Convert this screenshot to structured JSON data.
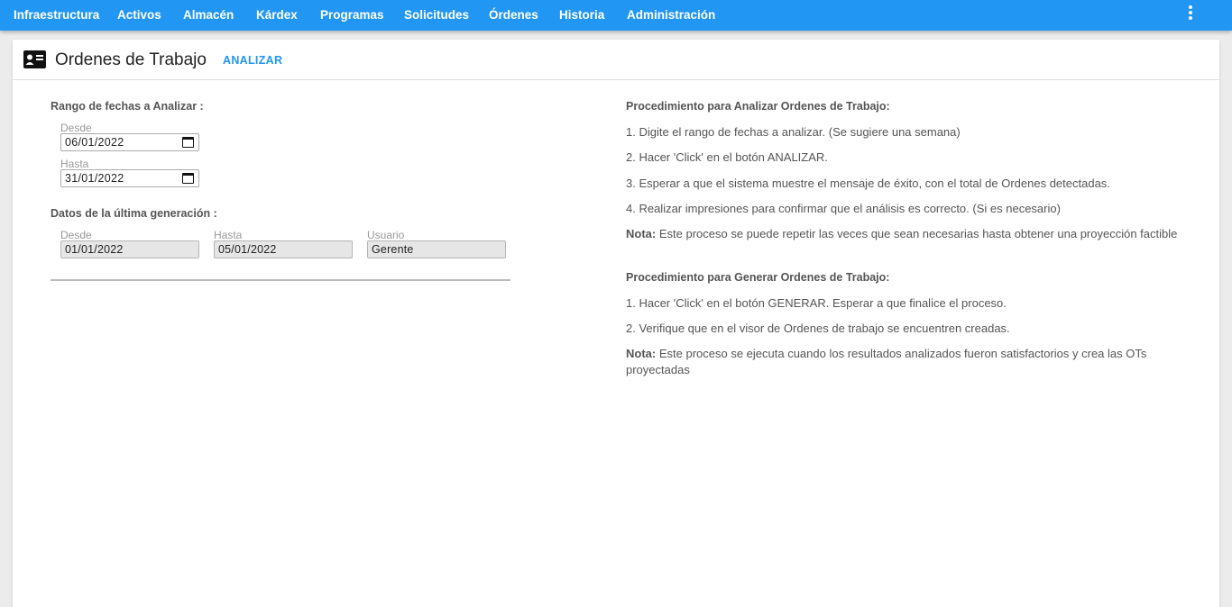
{
  "nav": {
    "items": [
      "Infraestructura",
      "Activos",
      "Almacén",
      "Kárdex",
      "Programas",
      "Solicitudes",
      "Órdenes",
      "Historia",
      "Administración"
    ],
    "more_icon": "more-vertical-icon",
    "color": "#2196f3"
  },
  "header": {
    "icon": "id-card-icon",
    "title": "Ordenes de Trabajo",
    "action_label": "ANALIZAR"
  },
  "range": {
    "section_label": "Rango de fechas a Analizar :",
    "from_label": "Desde",
    "from_value": "06/01/2022",
    "to_label": "Hasta",
    "to_value": "31/01/2022"
  },
  "last_generation": {
    "section_label": "Datos de la última generación :",
    "from_label": "Desde",
    "from_value": "01/01/2022",
    "to_label": "Hasta",
    "to_value": "05/01/2022",
    "user_label": "Usuario",
    "user_value": "Gerente"
  },
  "analyze_procedure": {
    "title": "Procedimiento para Analizar Ordenes de Trabajo:",
    "steps": [
      "1. Digite el rango de fechas a analizar. (Se sugiere una semana)",
      "2. Hacer 'Click' en el botón ANALIZAR.",
      "3. Esperar a que el sistema muestre el mensaje de éxito, con el total de Ordenes detectadas.",
      "4. Realizar impresiones para confirmar que el análisis es correcto. (Si es necesario)"
    ],
    "note_label": "Nota:",
    "note_text": "Este proceso se puede repetir las veces que sean necesarias hasta obtener una proyección factible"
  },
  "generate_procedure": {
    "title": "Procedimiento para Generar Ordenes de Trabajo:",
    "steps": [
      "1. Hacer 'Click' en el botón GENERAR. Esperar a que finalice el proceso.",
      "2. Verifique que en el visor de Ordenes de trabajo se encuentren creadas."
    ],
    "note_label": "Nota:",
    "note_text": "Este proceso se ejecuta cuando los resultados analizados fueron satisfactorios y crea las OTs proyectadas"
  }
}
